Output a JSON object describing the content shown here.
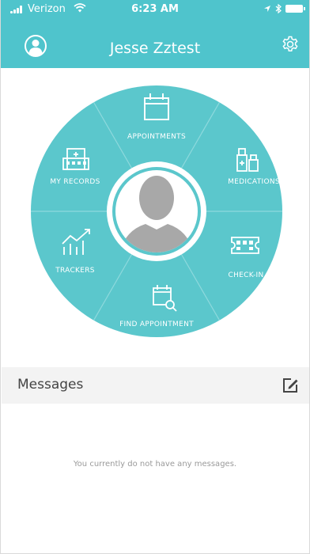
{
  "status_bar": {
    "carrier": "Verizon",
    "time": "6:23 AM",
    "icons": [
      "signal-icon",
      "wifi-icon",
      "location-arrow-icon",
      "bluetooth-icon",
      "battery-icon"
    ]
  },
  "header": {
    "title": "Jesse Zztest",
    "left_icon": "user-avatar-icon",
    "right_icon": "gear-icon"
  },
  "dashboard": {
    "items": [
      {
        "label": "APPOINTMENTS",
        "icon": "calendar-icon"
      },
      {
        "label": "MEDICATIONS",
        "icon": "medication-bottles-icon"
      },
      {
        "label": "CHECK-IN",
        "icon": "qr-ticket-icon"
      },
      {
        "label": "FIND APPOINTMENT",
        "icon": "calendar-search-icon"
      },
      {
        "label": "TRACKERS",
        "icon": "trend-chart-icon"
      },
      {
        "label": "MY RECORDS",
        "icon": "hospital-building-icon"
      }
    ],
    "center_icon": "profile-silhouette-icon"
  },
  "messages": {
    "title": "Messages",
    "compose_icon": "compose-icon",
    "empty_text": "You currently do not have any messages."
  },
  "colors": {
    "accent": "#4fc4cc",
    "wheel": "#5bc7cc",
    "divider": "#8ed9dd",
    "messages_header_bg": "#f3f3f3",
    "avatar_gray": "#a8a8a8"
  }
}
